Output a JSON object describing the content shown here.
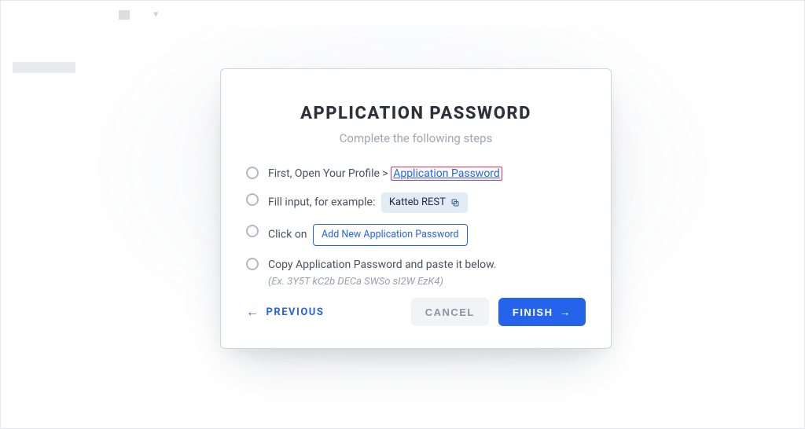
{
  "modal": {
    "title": "APPLICATION PASSWORD",
    "subtitle": "Complete the following steps"
  },
  "steps": {
    "step1_prefix": "First, Open Your Profile > ",
    "step1_link": "Application Password",
    "step2_prefix": "Fill input, for example:",
    "step2_pill": "Katteb REST",
    "step3_prefix": "Click on",
    "step3_button": "Add New Application Password",
    "step4_line1": "Copy Application Password and paste it below.",
    "step4_hint": "(Ex. 3Y5T kC2b DECa SWSo sI2W EzK4)"
  },
  "footer": {
    "previous": "PREVIOUS",
    "cancel": "CANCEL",
    "finish": "FINISH"
  }
}
